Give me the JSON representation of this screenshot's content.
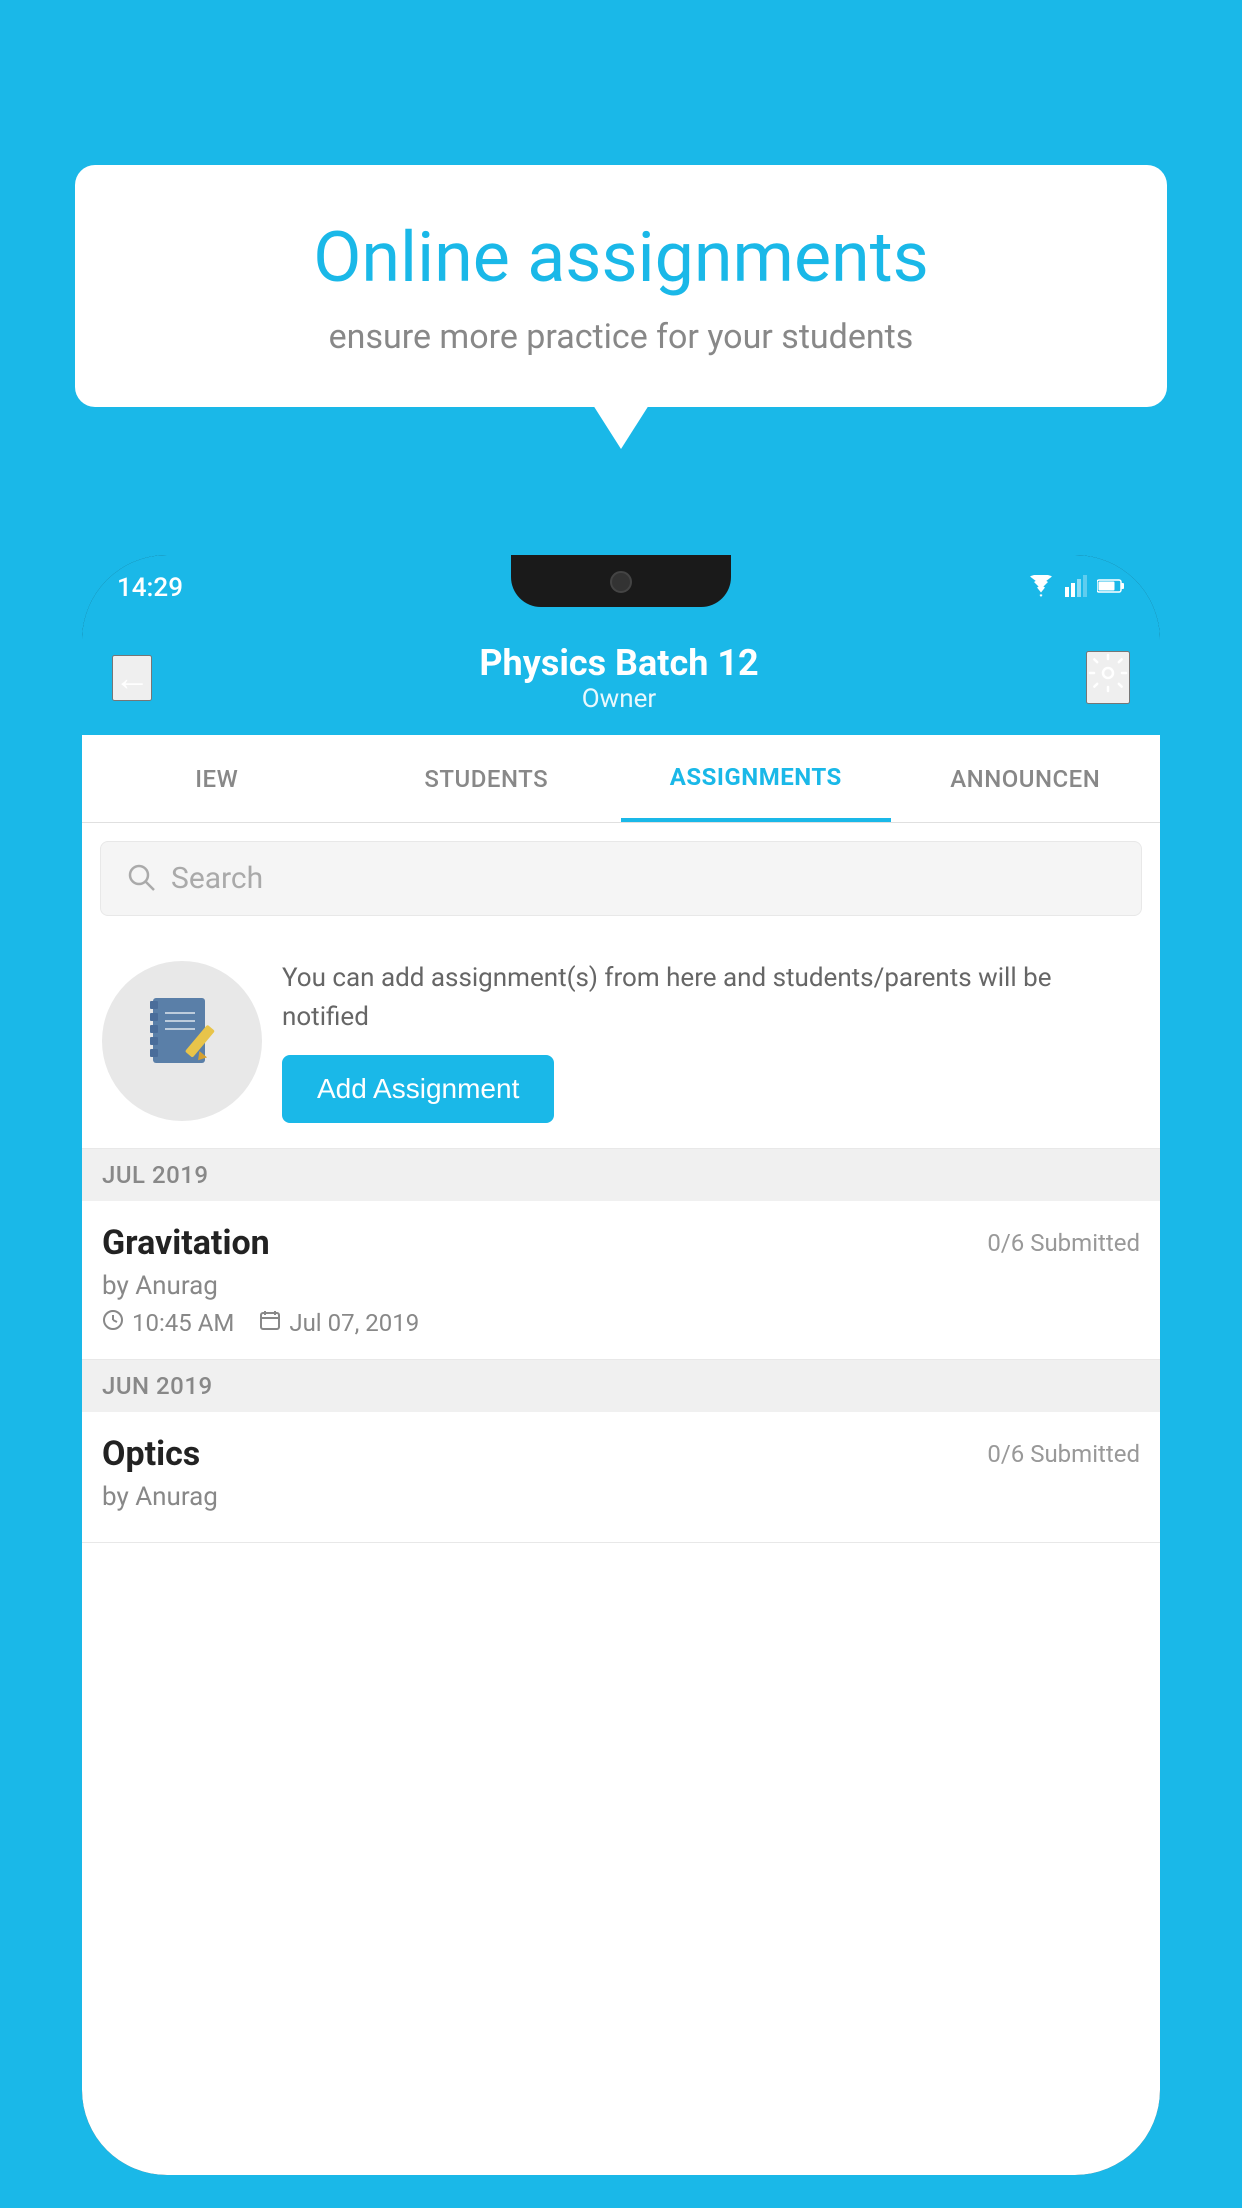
{
  "background_color": "#1ab8e8",
  "speech_bubble": {
    "title": "Online assignments",
    "subtitle": "ensure more practice for your students"
  },
  "status_bar": {
    "time": "14:29",
    "wifi": "▼",
    "signal": "▲",
    "battery": "▮"
  },
  "header": {
    "title": "Physics Batch 12",
    "subtitle": "Owner",
    "back_label": "←",
    "settings_label": "⚙"
  },
  "tabs": [
    {
      "id": "view",
      "label": "IEW",
      "active": false
    },
    {
      "id": "students",
      "label": "STUDENTS",
      "active": false
    },
    {
      "id": "assignments",
      "label": "ASSIGNMENTS",
      "active": true
    },
    {
      "id": "announcements",
      "label": "ANNOUNCEN",
      "active": false
    }
  ],
  "search": {
    "placeholder": "Search"
  },
  "promo": {
    "description": "You can add assignment(s) from here and students/parents will be notified",
    "button_label": "Add Assignment"
  },
  "sections": [
    {
      "label": "JUL 2019",
      "assignments": [
        {
          "title": "Gravitation",
          "submitted": "0/6 Submitted",
          "by": "by Anurag",
          "time": "10:45 AM",
          "date": "Jul 07, 2019"
        }
      ]
    },
    {
      "label": "JUN 2019",
      "assignments": [
        {
          "title": "Optics",
          "submitted": "0/6 Submitted",
          "by": "by Anurag",
          "time": "",
          "date": ""
        }
      ]
    }
  ]
}
